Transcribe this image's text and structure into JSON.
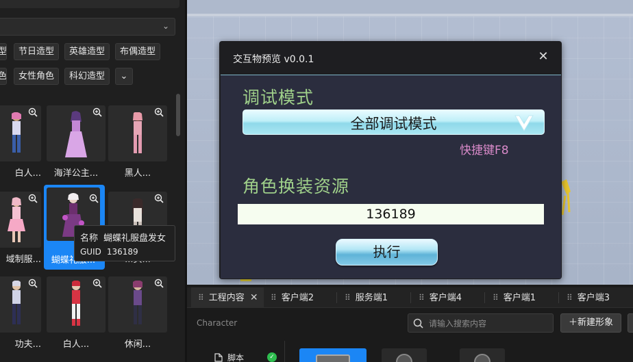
{
  "left_panel": {
    "tags_row1": [
      "型",
      "节日造型",
      "英雄造型",
      "布偶造型"
    ],
    "tags_row2": [
      "色",
      "女性角色",
      "科幻造型"
    ],
    "more_tags_icon": "chevron-down-icon",
    "select_icon": "chevron-down-icon",
    "cards": [
      {
        "name": "白人..."
      },
      {
        "name": "海洋公主..."
      },
      {
        "name": "黑人..."
      },
      {
        "name": "域制服..."
      },
      {
        "name": "蝴蝶礼服..."
      },
      {
        "name": "...头..."
      },
      {
        "name": "功夫..."
      },
      {
        "name": "白人..."
      },
      {
        "name": "休闲..."
      }
    ],
    "tooltip": {
      "name_label": "名称",
      "name_value": "蝴蝶礼服盘发女",
      "guid_label": "GUID",
      "guid_value": "136189"
    }
  },
  "dialog": {
    "title": "交互物预览 v0.0.1",
    "close_icon": "close-icon",
    "debug_mode_label": "调试模式",
    "debug_mode_value": "全部调试模式",
    "shortcut_hint": "快捷键F8",
    "resource_label": "角色换装资源",
    "resource_value": "136189",
    "execute_label": "执行"
  },
  "bottom_panel": {
    "tabs": [
      {
        "label": "工程内容",
        "active": true,
        "closable": true
      },
      {
        "label": "客户端2"
      },
      {
        "label": "服务端1"
      },
      {
        "label": "客户端4"
      },
      {
        "label": "客户端1"
      },
      {
        "label": "客户端3"
      }
    ],
    "breadcrumb": "Character",
    "search_placeholder": "请输入搜索内容",
    "new_button_label": "新建形象",
    "script_label": "脚本"
  },
  "colors": {
    "accent_blue": "#1b86f5",
    "label_green": "#9fd08a",
    "hint_pink": "#d98ac9",
    "status_green": "#2ebd4f"
  }
}
